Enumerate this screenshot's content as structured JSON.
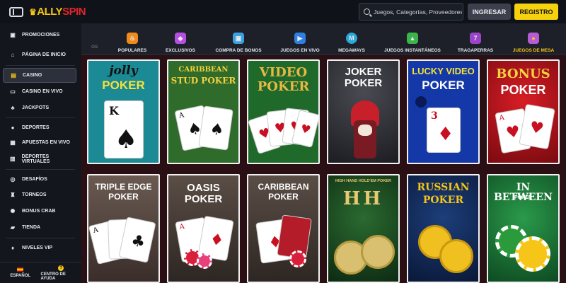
{
  "header": {
    "logo_text_1": "ALLY",
    "logo_text_2": "SPIN",
    "search_placeholder": "Juegos, Categorías, Proveedores",
    "login_label": "INGRESAR",
    "register_label": "REGISTRO"
  },
  "sidebar": {
    "items": [
      {
        "label": "Promociones",
        "icon": "gift-icon"
      },
      {
        "label": "Página de inicio",
        "icon": "home-icon"
      },
      {
        "label": "Casino",
        "icon": "slot-icon"
      },
      {
        "label": "Casino en vivo",
        "icon": "live-icon"
      },
      {
        "label": "Jackpots",
        "icon": "clover-icon"
      },
      {
        "label": "Deportes",
        "icon": "ball-icon"
      },
      {
        "label": "Apuestas en vivo",
        "icon": "live-bets-icon"
      },
      {
        "label": "Deportes virtuales",
        "icon": "virtual-sports-icon"
      },
      {
        "label": "Desafíos",
        "icon": "challenge-icon"
      },
      {
        "label": "Torneos",
        "icon": "trophy-icon"
      },
      {
        "label": "Bonus Crab",
        "icon": "crab-icon"
      },
      {
        "label": "Tienda",
        "icon": "shop-icon"
      },
      {
        "label": "Niveles VIP",
        "icon": "vip-icon"
      }
    ],
    "active": "Casino",
    "language_label": "ESPAÑOL",
    "help_label": "CENTRO DE AYUDA"
  },
  "categories": {
    "faded_label": "OS",
    "items": [
      {
        "label": "POPULARES",
        "icon": "flame-icon",
        "color": "#f08a1c"
      },
      {
        "label": "EXCLUSIVOS",
        "icon": "gem-icon",
        "color": "#b44fe0"
      },
      {
        "label": "COMPRA DE BONOS",
        "icon": "gift-box-icon",
        "color": "#3aa0e0"
      },
      {
        "label": "JUEGOS EN VIVO",
        "icon": "play-icon",
        "color": "#2f7fe0"
      },
      {
        "label": "MEGAWAYS",
        "icon": "megaways-icon",
        "color": "#2aa6d8"
      },
      {
        "label": "JUEGOS INSTANTÁNEOS",
        "icon": "instant-icon",
        "color": "#3bb44a"
      },
      {
        "label": "TRAGAPERRAS",
        "icon": "slot-machine-icon",
        "color": "#9a45c8"
      },
      {
        "label": "JUEGOS DE MESA",
        "icon": "cards-icon",
        "color": "#b55bd6"
      }
    ],
    "active": "JUEGOS DE MESA"
  },
  "games": [
    {
      "line1": "jolly",
      "line2": "POKER",
      "bg": "#1b8a94",
      "card": "K♠"
    },
    {
      "line1": "CARIBBEAN",
      "line2": "STUD POKER",
      "bg": "#2f6b2a",
      "card": "A♠"
    },
    {
      "line1": "VIDEO",
      "line2": "POKER",
      "bg": "#1f6a2b",
      "card": "A♥"
    },
    {
      "line1": "JOKER",
      "line2": "POKER",
      "bg": "#2a2a2f",
      "card": ""
    },
    {
      "line1": "LUCKY VIDEO",
      "line2": "POKER",
      "bg": "#1438a8",
      "card": "3♦"
    },
    {
      "line1": "BONUS",
      "line2": "POKER",
      "bg": "#b01018",
      "card": "A♥"
    },
    {
      "line1": "TRIPLE EDGE",
      "line2": "POKER",
      "bg": "#5a4a44",
      "card": "A♣"
    },
    {
      "line1": "OASIS",
      "line2": "POKER",
      "bg": "#4e433c",
      "card": "A♥"
    },
    {
      "line1": "CARIBBEAN",
      "line2": "POKER",
      "bg": "#4a3f3a",
      "card": "♦"
    },
    {
      "line1": "HIGH HAND HOLD'EM POKER",
      "line2": "HH",
      "bg": "#1e4a22",
      "card": ""
    },
    {
      "line1": "RUSSIAN",
      "line2": "POKER",
      "bg": "#122c5c",
      "card": ""
    },
    {
      "line1": "IN BETWEEN",
      "line2": "POKER",
      "bg": "#1c7a3c",
      "card": ""
    }
  ]
}
